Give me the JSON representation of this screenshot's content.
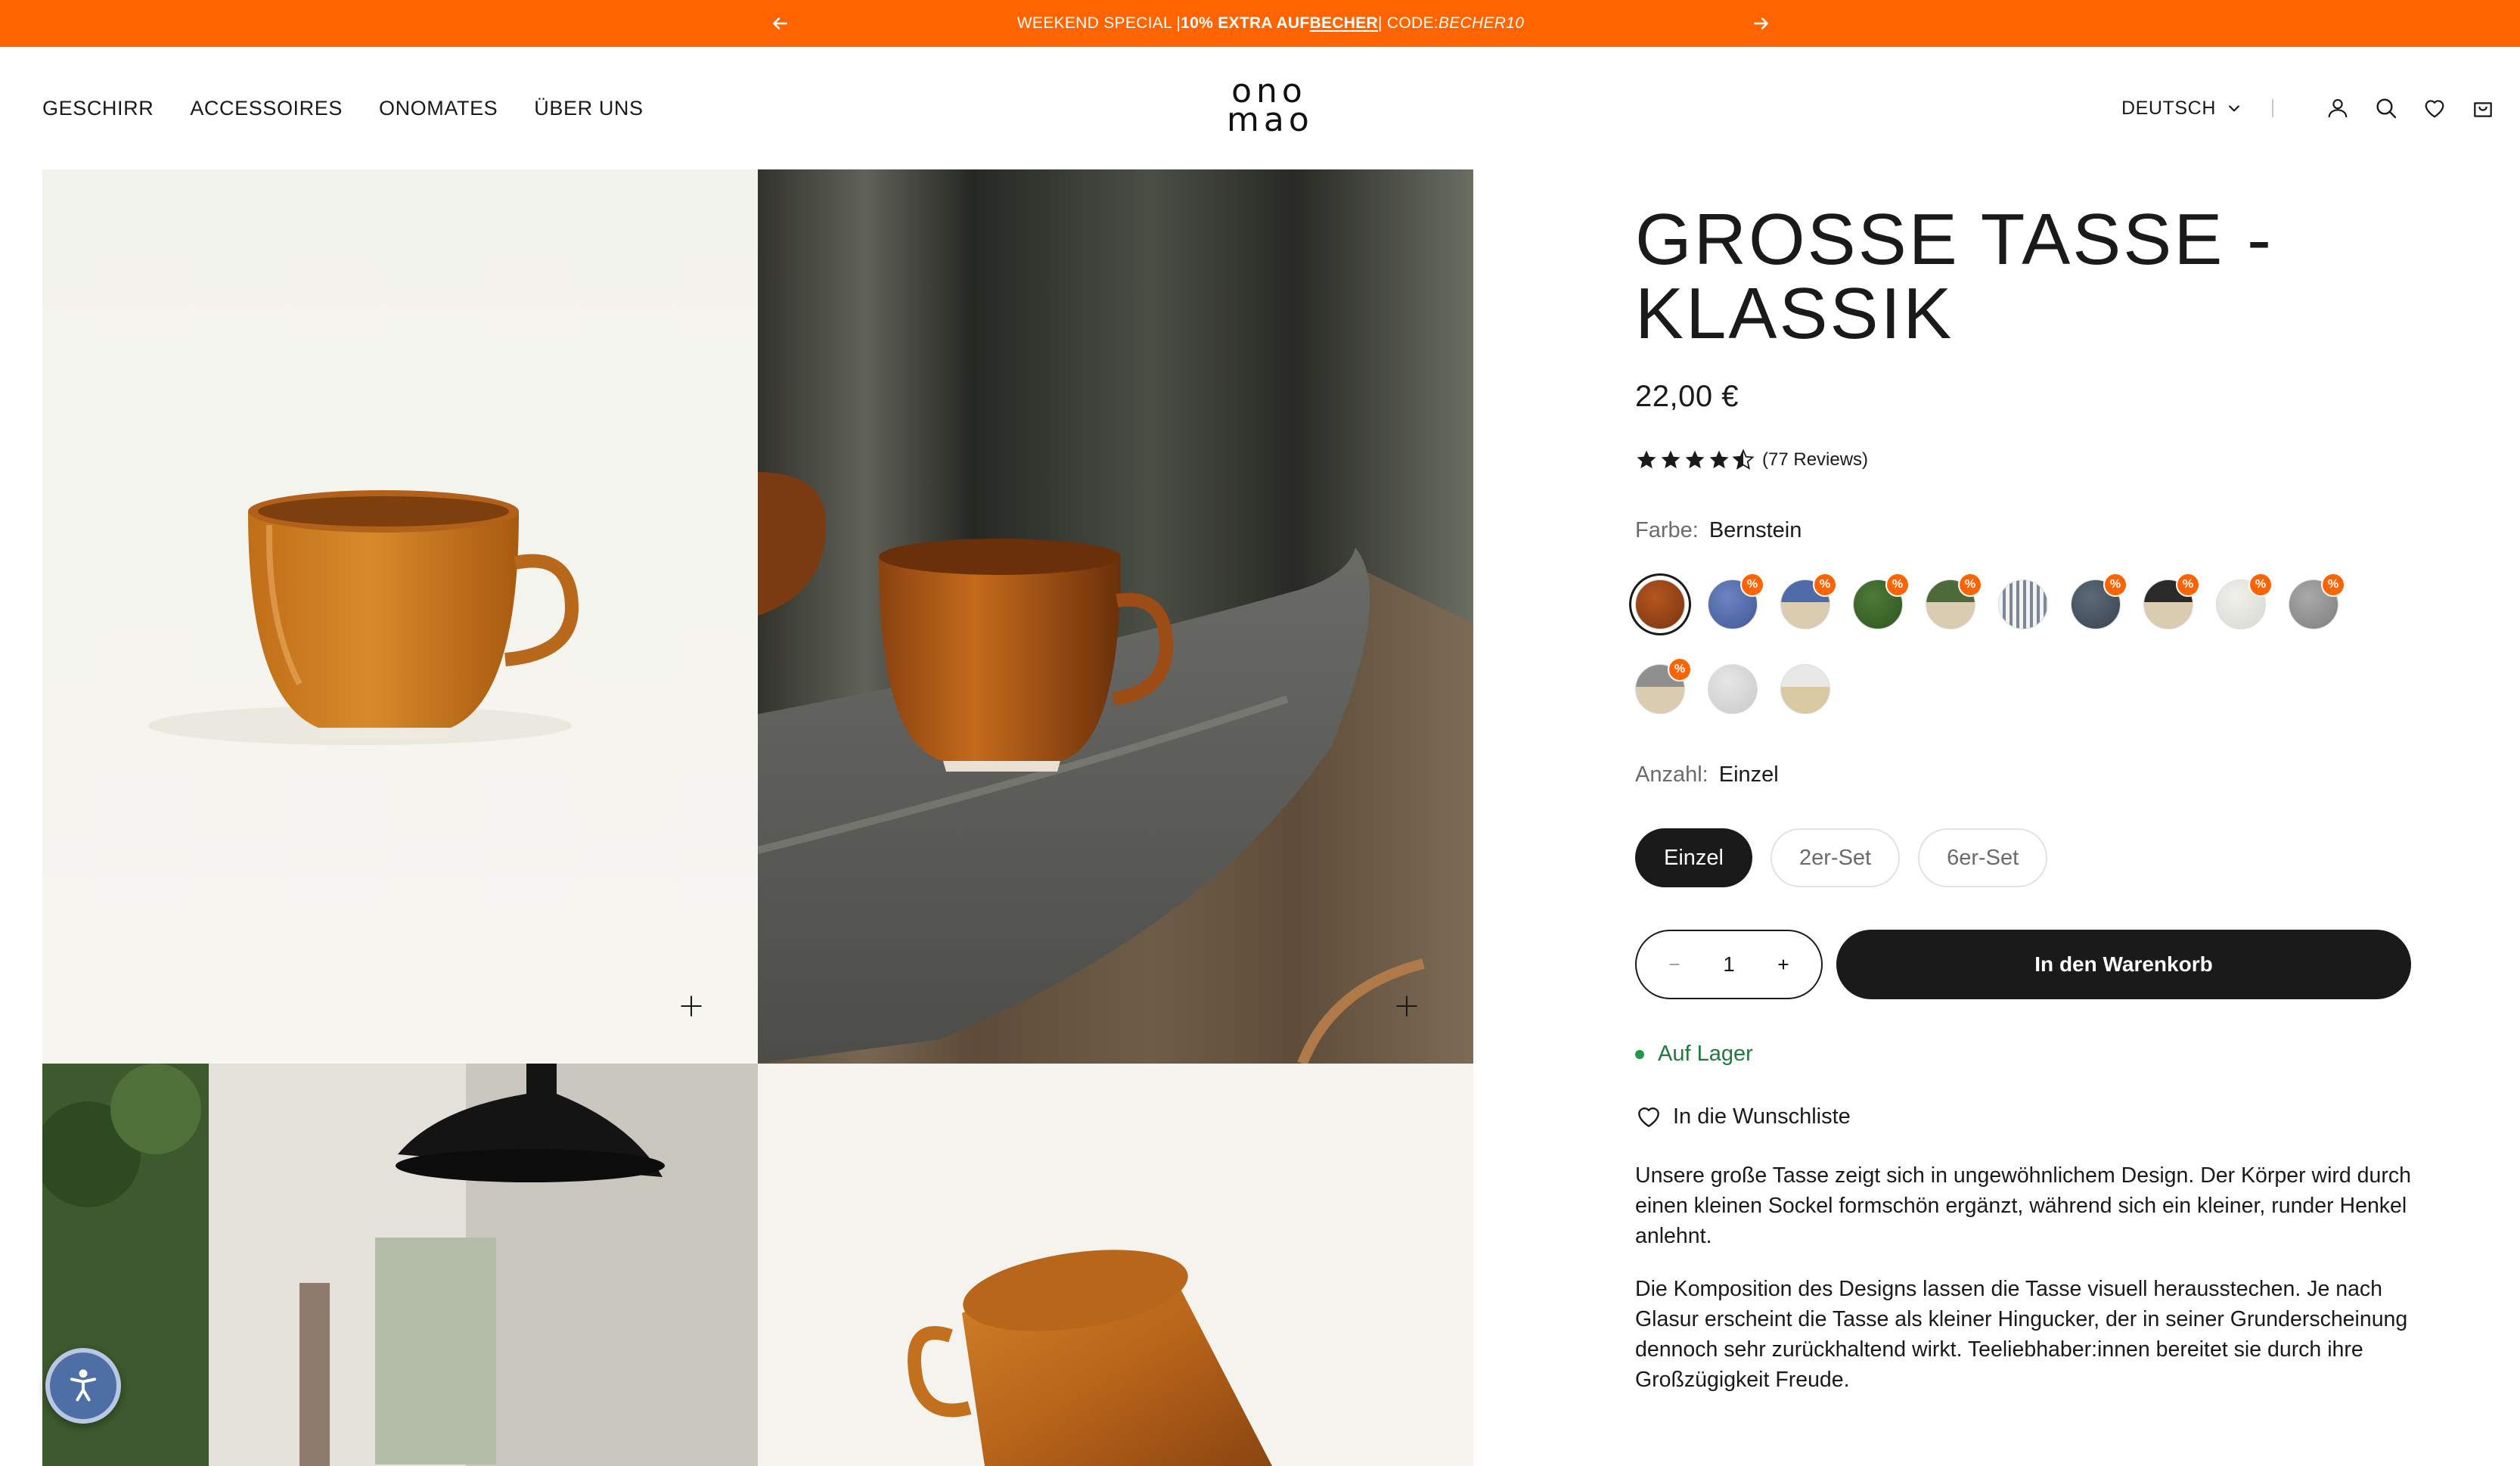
{
  "announcement": {
    "prefix": "WEEKEND SPECIAL | ",
    "bold": "10% EXTRA AUF ",
    "link": "BECHER",
    "middle": " | CODE: ",
    "code": "BECHER10"
  },
  "nav": {
    "items": [
      "GESCHIRR",
      "ACCESSOIRES",
      "ONOMATES",
      "ÜBER UNS"
    ]
  },
  "logo": {
    "line1": "ono",
    "line2": "mao"
  },
  "language": {
    "label": "DEUTSCH"
  },
  "product": {
    "title_line1": "GROSSE TASSE -",
    "title_line2": "KLASSIK",
    "price": "22,00 €",
    "rating": 4.5,
    "reviews": "(77 Reviews)",
    "color_label": "Farbe:",
    "color_value": "Bernstein",
    "quantity_label": "Anzahl:",
    "quantity_value": "Einzel",
    "variants": [
      "Einzel",
      "2er-Set",
      "6er-Set"
    ],
    "qty": "1",
    "cart_label": "In den Warenkorb",
    "stock": "Auf Lager",
    "wishlist": "In die Wunschliste",
    "description": [
      "Unsere große Tasse zeigt sich in ungewöhnlichem Design. Der Körper wird durch einen kleinen Sockel formschön ergänzt, während sich ein kleiner, runder Henkel anlehnt.",
      "Die Komposition des Designs lassen die Tasse visuell herausstechen. Je nach Glasur erscheint die Tasse als kleiner Hingucker, der in seiner Grunderscheinung dennoch sehr zurückhaltend wirkt. Teeliebhaber:innen bereitet sie durch ihre Großzügigkeit Freude."
    ]
  },
  "swatch_badge": "%",
  "swatches": [
    {
      "style": "radial-gradient(circle at 40% 35%, #b4561f, #7a3410)",
      "discount": false,
      "selected": true
    },
    {
      "style": "radial-gradient(circle at 40% 35%, #6c84be, #41579a)",
      "discount": true
    },
    {
      "style": "linear-gradient(180deg, #4f6aa8 0 45%, #d9ccb0 45% 100%)",
      "discount": true
    },
    {
      "style": "radial-gradient(circle at 40% 35%, #4e7a38, #2f5520)",
      "discount": true
    },
    {
      "style": "linear-gradient(180deg, #4d6a3a 0 45%, #d9ccb0 45% 100%)",
      "discount": true
    },
    {
      "style": "repeating-linear-gradient(90deg, #f2f2f2 0 5px, #7d8694 5px 9px)",
      "discount": false
    },
    {
      "style": "radial-gradient(circle at 40% 35%, #5c6a78, #38434f)",
      "discount": true
    },
    {
      "style": "linear-gradient(180deg, #2a2a2a 0 45%, #d9ccb0 45% 100%)",
      "discount": true
    },
    {
      "style": "radial-gradient(circle at 40% 35%, #f0f0ec, #d8d8d2)",
      "discount": true
    },
    {
      "style": "radial-gradient(circle at 40% 35%, #a9a9a9, #7e7e7e)",
      "discount": true
    },
    {
      "style": "linear-gradient(180deg, #8f8f8f 0 45%, #d9ccb0 45% 100%)",
      "discount": true
    },
    {
      "style": "radial-gradient(circle at 40% 35%, #e6e6e6, #c9c9c9)",
      "discount": false
    },
    {
      "style": "linear-gradient(180deg, #e8e8e4 0 45%, #d9c9a2 45% 100%)",
      "discount": false
    }
  ],
  "colors": {
    "accent": "#ff6400",
    "dark": "#1a1a1a",
    "stock_green": "#1f7a3c"
  }
}
